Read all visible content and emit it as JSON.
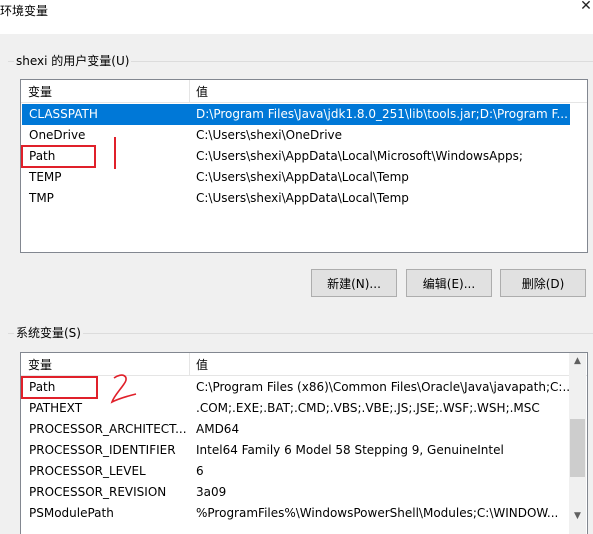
{
  "window": {
    "title": "环境变量",
    "close_glyph": "✕"
  },
  "user_vars": {
    "group_label": "shexi 的用户变量(U)",
    "col_variable": "变量",
    "col_value": "值",
    "rows": [
      {
        "name": "CLASSPATH",
        "value": "D:\\Program Files\\Java\\jdk1.8.0_251\\lib\\tools.jar;D:\\Program F...",
        "selected": true
      },
      {
        "name": "OneDrive",
        "value": "C:\\Users\\shexi\\OneDrive"
      },
      {
        "name": "Path",
        "value": "C:\\Users\\shexi\\AppData\\Local\\Microsoft\\WindowsApps;"
      },
      {
        "name": "TEMP",
        "value": "C:\\Users\\shexi\\AppData\\Local\\Temp"
      },
      {
        "name": "TMP",
        "value": "C:\\Users\\shexi\\AppData\\Local\\Temp"
      }
    ],
    "buttons": {
      "new": "新建(N)...",
      "edit": "编辑(E)...",
      "delete": "删除(D)"
    }
  },
  "system_vars": {
    "group_label": "系统变量(S)",
    "col_variable": "变量",
    "col_value": "值",
    "rows": [
      {
        "name": "Path",
        "value": "C:\\Program Files (x86)\\Common Files\\Oracle\\Java\\javapath;C:..."
      },
      {
        "name": "PATHEXT",
        "value": ".COM;.EXE;.BAT;.CMD;.VBS;.VBE;.JS;.JSE;.WSF;.WSH;.MSC"
      },
      {
        "name": "PROCESSOR_ARCHITECT...",
        "value": "AMD64"
      },
      {
        "name": "PROCESSOR_IDENTIFIER",
        "value": "Intel64 Family 6 Model 58 Stepping 9, GenuineIntel"
      },
      {
        "name": "PROCESSOR_LEVEL",
        "value": "6"
      },
      {
        "name": "PROCESSOR_REVISION",
        "value": "3a09"
      },
      {
        "name": "PSModulePath",
        "value": "%ProgramFiles%\\WindowsPowerShell\\Modules;C:\\WINDOW..."
      }
    ]
  },
  "colors": {
    "selection": "#0078d7",
    "annotation_red": "#e0202a"
  }
}
